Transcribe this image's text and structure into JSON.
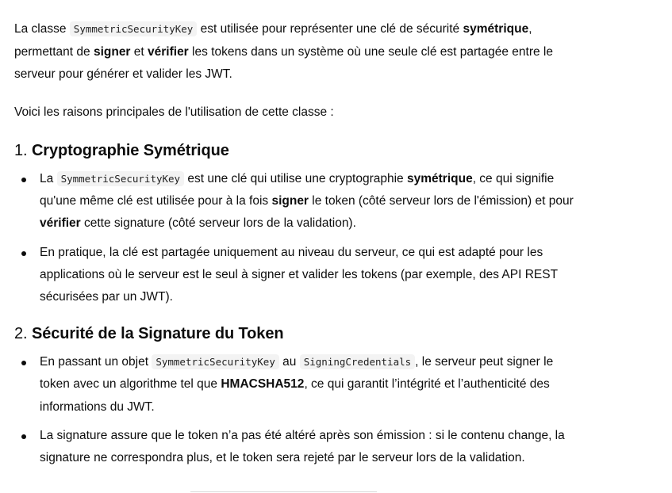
{
  "intro": {
    "t1": "La classe ",
    "code1": "SymmetricSecurityKey",
    "t2": " est utilisée pour représenter une clé de sécurité ",
    "b1": "symétrique",
    "t3": ", permettant de ",
    "b2": "signer",
    "t4": " et ",
    "b3": "vérifier",
    "t5": " les tokens dans un système où une seule clé est partagée entre le serveur pour générer et valider les JWT."
  },
  "lead": "Voici les raisons principales de l'utilisation de cette classe :",
  "section1": {
    "number": "1.",
    "title": "Cryptographie Symétrique",
    "item1": {
      "t1": "La ",
      "code1": "SymmetricSecurityKey",
      "t2": " est une clé qui utilise une cryptographie ",
      "b1": "symétrique",
      "t3": ", ce qui signifie qu'une même clé est utilisée pour à la fois ",
      "b2": "signer",
      "t4": " le token (côté serveur lors de l'émission) et pour ",
      "b3": "vérifier",
      "t5": " cette signature (côté serveur lors de la validation)."
    },
    "item2": {
      "text": "En pratique, la clé est partagée uniquement au niveau du serveur, ce qui est adapté pour les applications où le serveur est le seul à signer et valider les tokens (par exemple, des API REST sécurisées par un JWT)."
    }
  },
  "section2": {
    "number": "2.",
    "title": "Sécurité de la Signature du Token",
    "item1": {
      "t1": "En passant un objet ",
      "code1": "SymmetricSecurityKey",
      "t2": " au ",
      "code2": "SigningCredentials",
      "t3": ", le serveur peut signer le token avec un algorithme tel que ",
      "b1": "HMACSHA512",
      "t4": ", ce qui garantit l’intégrité et l’authenticité des informations du JWT."
    },
    "item2": {
      "text": "La signature assure que le token n’a pas été altéré après son émission : si le contenu change, la signature ne correspondra plus, et le token sera rejeté par le serveur lors de la validation."
    }
  }
}
